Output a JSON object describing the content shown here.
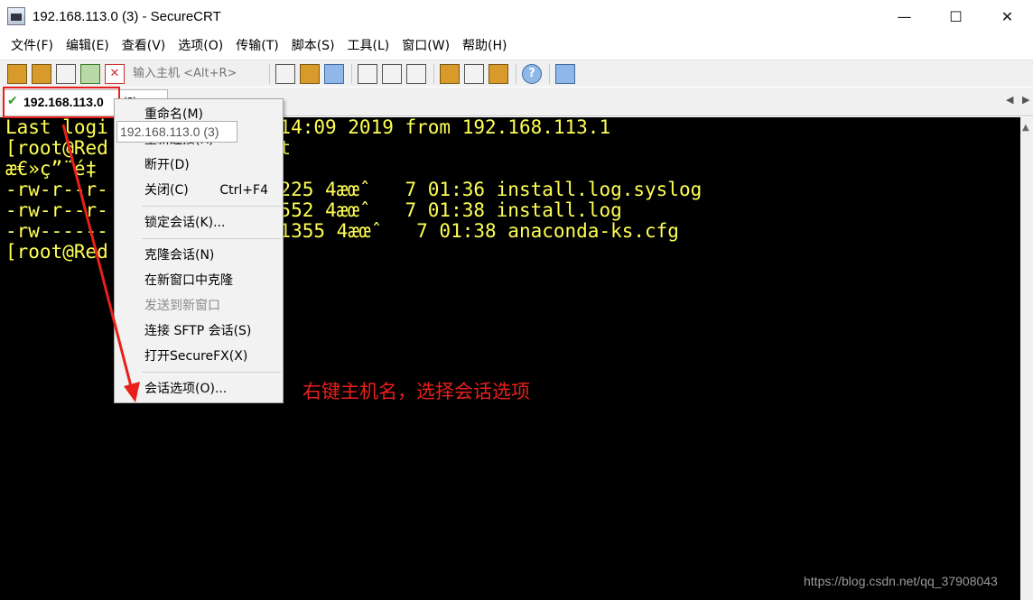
{
  "window": {
    "title": "192.168.113.0 (3) - SecureCRT",
    "minimize_label": "—",
    "maximize_label": "☐",
    "close_label": "✕"
  },
  "menubar": {
    "items": [
      "文件(F)",
      "编辑(E)",
      "查看(V)",
      "选项(O)",
      "传输(T)",
      "脚本(S)",
      "工具(L)",
      "窗口(W)",
      "帮助(H)"
    ]
  },
  "toolbar": {
    "host_input_placeholder": "输入主机 <Alt+R>"
  },
  "tab": {
    "label": "192.168.113.0",
    "suffix": "(3)",
    "status_icon": "check-icon"
  },
  "tooltip": {
    "text": "192.168.113.0 (3)"
  },
  "terminal": {
    "lines": [
      "Last logi            04:14:09 2019 from 192.168.113.1",
      "[root@Red             lrt",
      "æ€»ç”¨é‡",
      "-rw-r--r-           t 10225 4æœˆ   7 01:36 install.log.syslog",
      "-rw-r--r-           t 46552 4æœˆ   7 01:38 install.log",
      "-rw------            t  1355 4æœˆ   7 01:38 anaconda-ks.cfg",
      "[root@Red"
    ],
    "text_color": "#ffff54",
    "background": "#000000"
  },
  "context_menu": {
    "items": [
      {
        "label": "重命名(M)",
        "shortcut": "",
        "disabled": false
      },
      {
        "label": "重新连接(R)",
        "shortcut": "",
        "disabled": false
      },
      {
        "label": "断开(D)",
        "shortcut": "",
        "disabled": false
      },
      {
        "label": "关闭(C)",
        "shortcut": "Ctrl+F4",
        "disabled": false
      },
      {
        "label": "锁定会话(K)...",
        "shortcut": "",
        "disabled": false
      },
      {
        "label": "克隆会话(N)",
        "shortcut": "",
        "disabled": false
      },
      {
        "label": "在新窗口中克隆",
        "shortcut": "",
        "disabled": false
      },
      {
        "label": "发送到新窗口",
        "shortcut": "",
        "disabled": true
      },
      {
        "label": "连接 SFTP 会话(S)",
        "shortcut": "",
        "disabled": false
      },
      {
        "label": "打开SecureFX(X)",
        "shortcut": "",
        "disabled": false
      },
      {
        "label": "会话选项(O)...",
        "shortcut": "",
        "disabled": false
      }
    ]
  },
  "annotation": {
    "text": "右键主机名，选择会话选项",
    "color": "#e8201b"
  },
  "watermark": {
    "text": "https://blog.csdn.net/qq_37908043"
  }
}
